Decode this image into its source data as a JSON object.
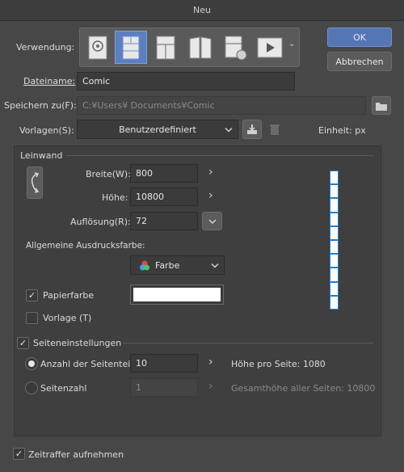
{
  "window": {
    "title": "Neu"
  },
  "usage": {
    "label": "Verwendung:"
  },
  "buttons": {
    "ok": "OK",
    "cancel": "Abbrechen"
  },
  "filename": {
    "label": "Dateiname:",
    "value": "Comic"
  },
  "save_to": {
    "label": "Speichern zu(F):",
    "value": "C:¥Users¥          Documents¥Comic"
  },
  "templates": {
    "label": "Vorlagen(S):",
    "value": "Benutzerdefiniert"
  },
  "unit": {
    "label": "Einheit: px"
  },
  "canvas": {
    "section_label": "Leinwand",
    "width": {
      "label": "Breite(W):",
      "value": "800"
    },
    "height": {
      "label": "Höhe:",
      "value": "10800"
    },
    "resolution": {
      "label": "Auflösung(R):",
      "value": "72"
    },
    "print_color": {
      "label": "Allgemeine Ausdrucksfarbe:",
      "value": "Farbe"
    },
    "paper_color": {
      "label": "Papierfarbe",
      "checked": true,
      "swatch": "#ffffff"
    },
    "template": {
      "label": "Vorlage (T)",
      "checked": false
    }
  },
  "page_settings": {
    "label": "Seiteneinstellungen",
    "checked": true,
    "parts": {
      "label": "Anzahl der Seitenteile",
      "value": "10",
      "info": "Höhe pro Seite: 1080",
      "selected": true
    },
    "count": {
      "label": "Seitenzahl",
      "value": "1",
      "info": "Gesamthöhe aller Seiten: 10800",
      "selected": false
    }
  },
  "timelapse": {
    "label": "Zeitraffer aufnehmen",
    "checked": true
  },
  "colors": {
    "accent": "#5575b5",
    "page_border": "#1e7fd9"
  }
}
